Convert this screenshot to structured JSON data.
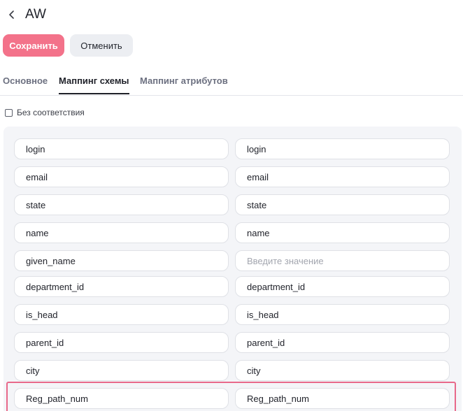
{
  "header": {
    "title": "AW"
  },
  "actions": {
    "save_label": "Сохранить",
    "cancel_label": "Отменить"
  },
  "tabs": [
    {
      "label": "Основное",
      "active": false
    },
    {
      "label": "Маппинг схемы",
      "active": true
    },
    {
      "label": "Маппинг атрибутов",
      "active": false
    }
  ],
  "no_match": {
    "label": "Без соответствия",
    "checked": false
  },
  "mapping_rows": [
    {
      "source": "login",
      "target": "login",
      "target_placeholder": ""
    },
    {
      "source": "email",
      "target": "email",
      "target_placeholder": ""
    },
    {
      "source": "state",
      "target": "state",
      "target_placeholder": ""
    },
    {
      "source": "name",
      "target": "name",
      "target_placeholder": ""
    },
    {
      "source": "given_name",
      "target": "",
      "target_placeholder": "Введите значение"
    },
    {
      "source": "department_id",
      "target": "department_id",
      "target_placeholder": ""
    },
    {
      "source": "is_head",
      "target": "is_head",
      "target_placeholder": ""
    },
    {
      "source": "parent_id",
      "target": "parent_id",
      "target_placeholder": ""
    },
    {
      "source": "city",
      "target": "city",
      "target_placeholder": ""
    },
    {
      "source": "Reg_path_num",
      "target": "Reg_path_num",
      "target_placeholder": "",
      "highlighted": true
    }
  ],
  "colors": {
    "accent": "#f3728a",
    "highlight": "#e8698a",
    "panel": "#f4f5f8"
  }
}
